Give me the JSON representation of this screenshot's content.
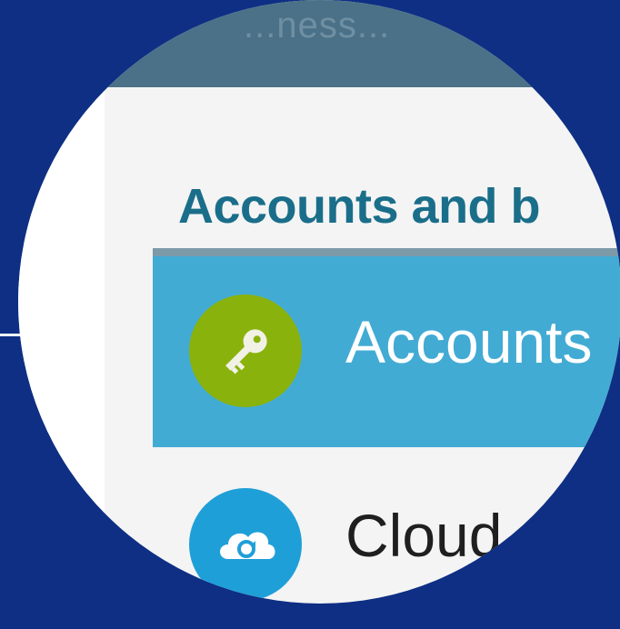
{
  "header": {
    "partial_title": "...ness..."
  },
  "section": {
    "heading": "Accounts and b"
  },
  "menu": {
    "items": [
      {
        "label": "Accounts",
        "icon": "key-icon",
        "selected": true,
        "icon_color": "#8ab20c"
      },
      {
        "label": "Cloud",
        "icon": "cloud-sync-icon",
        "selected": false,
        "icon_color": "#1f9fd8"
      }
    ]
  },
  "colors": {
    "background": "#0e2f84",
    "selected_row": "#42abd4",
    "heading": "#1a6e8a"
  }
}
